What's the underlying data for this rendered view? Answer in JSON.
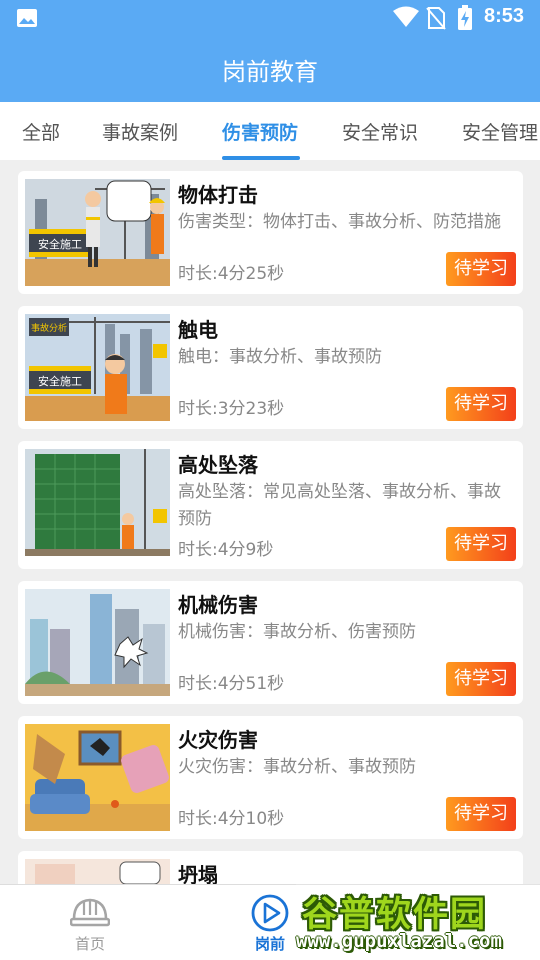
{
  "status_bar": {
    "time": "8:53",
    "icons": [
      "gallery-icon",
      "wifi-icon",
      "no-sim-icon",
      "battery-charging-icon"
    ]
  },
  "app_bar": {
    "title": "岗前教育"
  },
  "tabs": [
    {
      "label": "全部",
      "active": false
    },
    {
      "label": "事故案例",
      "active": false
    },
    {
      "label": "伤害预防",
      "active": true
    },
    {
      "label": "安全常识",
      "active": false
    },
    {
      "label": "安全管理",
      "active": false
    }
  ],
  "courses": [
    {
      "title": "物体打击",
      "description": "伤害类型：物体打击、事故分析、防范措施",
      "duration": "时长:4分25秒",
      "action": "待学习",
      "thumb_signs": [
        "安全施工"
      ],
      "thumb": "construction-site-worker"
    },
    {
      "title": "触电",
      "description": "触电：事故分析、事故预防",
      "duration": "时长:3分23秒",
      "action": "待学习",
      "thumb_signs": [
        "事故分析",
        "安全施工"
      ],
      "thumb": "construction-site-worker"
    },
    {
      "title": "高处坠落",
      "description": "高处坠落：常见高处坠落、事故分析、事故预防",
      "duration": "时长:4分9秒",
      "action": "待学习",
      "thumb": "building-scaffold-net"
    },
    {
      "title": "机械伤害",
      "description": "机械伤害：事故分析、伤害预防",
      "duration": "时长:4分51秒",
      "action": "待学习",
      "thumb": "city-buildings-crash"
    },
    {
      "title": "火灾伤害",
      "description": "火灾伤害：事故分析、事故预防",
      "duration": "时长:4分10秒",
      "action": "待学习",
      "thumb": "living-room-fire"
    },
    {
      "title": "坍塌",
      "description": "",
      "duration": "",
      "action": "",
      "thumb": "construction-collapse"
    }
  ],
  "bottom_nav": [
    {
      "label": "首页",
      "icon": "hard-hat-icon",
      "active": false
    },
    {
      "label": "岗前",
      "icon": "play-circle-icon",
      "active": true
    }
  ],
  "watermark": {
    "main": "谷普软件园",
    "url": "www.gupuxlazal.com"
  },
  "colors": {
    "primary": "#5aaaf4",
    "tab_active": "#2f8fe6",
    "button_start": "#ff9a1f",
    "button_end": "#f3401a",
    "nav_active": "#1a73d6"
  }
}
